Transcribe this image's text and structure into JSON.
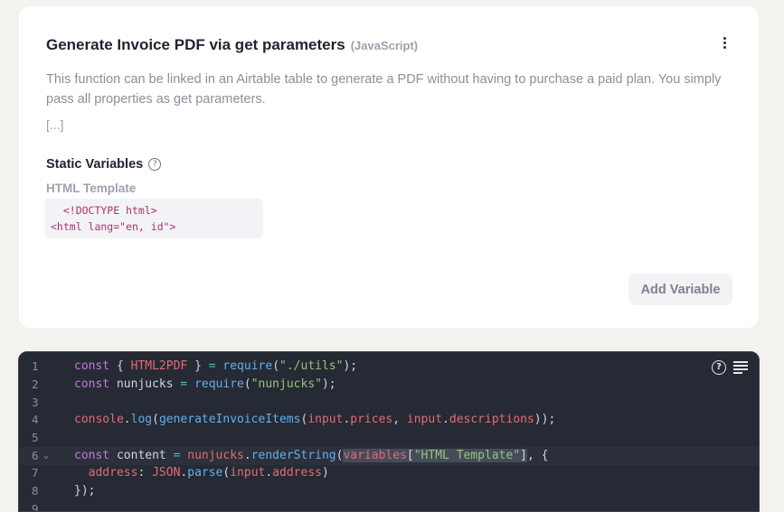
{
  "card": {
    "title": "Generate Invoice PDF via get parameters",
    "language": "(JavaScript)",
    "description": "This function can be linked in an Airtable table to generate a PDF without having to purchase a paid plan. You simply pass all properties as get parameters.",
    "more": "[...]",
    "static_variables_label": "Static Variables",
    "variable_name": "HTML Template",
    "variable_preview": [
      "  <!DOCTYPE html>",
      "<html lang=\"en, id\">"
    ],
    "add_variable_label": "Add Variable"
  },
  "editor": {
    "line_numbers": [
      "1",
      "2",
      "3",
      "4",
      "5",
      "6",
      "7",
      "8",
      "9"
    ],
    "fold_marker": "⌄",
    "help_icon": "help-circle-icon",
    "wrap_icon": "wrap-lines-icon"
  },
  "colors": {
    "accent_keyword": "#c678dd",
    "string": "#98c379",
    "variable": "#e06c75",
    "function": "#61afef"
  }
}
